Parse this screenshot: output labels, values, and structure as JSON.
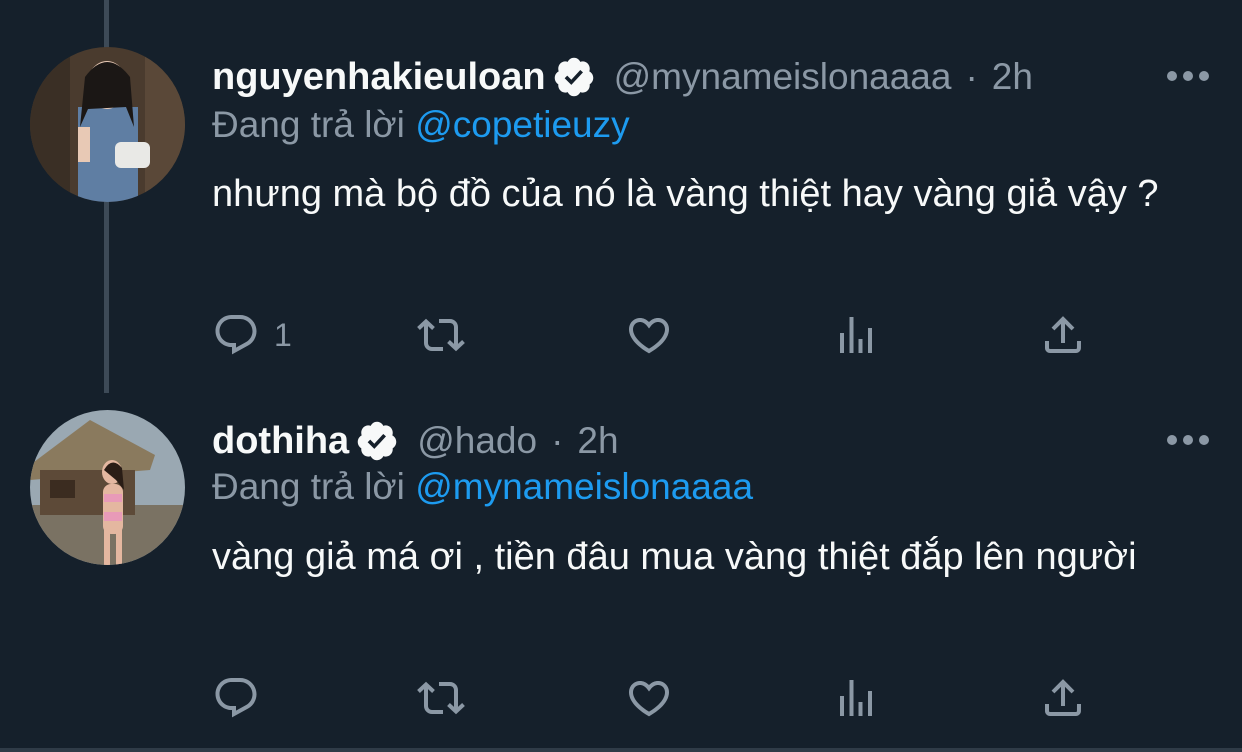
{
  "tweets": [
    {
      "display_name": "nguyenhakieuloan",
      "handle": "@mynameislonaaaa",
      "separator": "·",
      "time": "2h",
      "replying_prefix": "Đang trả lời",
      "replying_to": "@copetieuzy",
      "text": "nhưng mà bộ đồ của nó là vàng thiệt hay vàng giả vậy ?",
      "reply_count": "1"
    },
    {
      "display_name": "dothiha",
      "handle": "@hado",
      "separator": "·",
      "time": "2h",
      "replying_prefix": "Đang trả lời",
      "replying_to": "@mynameislonaaaa",
      "text": "vàng giả má ơi , tiền đâu mua vàng thiệt đắp lên người",
      "reply_count": ""
    }
  ],
  "colors": {
    "background": "#15202b",
    "text": "#f7f9f9",
    "secondary": "#8b98a5",
    "link": "#1d9bf0"
  },
  "icons": [
    "verified-badge-icon",
    "more-icon",
    "reply-icon",
    "retweet-icon",
    "like-icon",
    "views-icon",
    "share-icon"
  ]
}
